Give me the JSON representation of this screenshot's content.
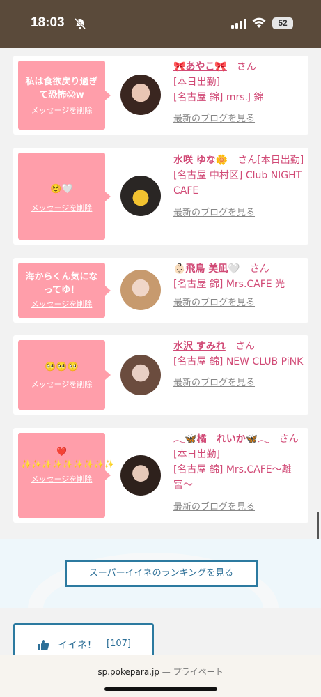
{
  "status_bar": {
    "time": "18:03",
    "battery": "52"
  },
  "cards": [
    {
      "message": "私は食欲戻り過ぎて恐怖😱w",
      "delete_label": "メッセージを削除",
      "name": "🎀あやこ🎀",
      "san": "さん",
      "lines": [
        "[本日出勤]",
        "[名古屋 錦] mrs.J 錦"
      ],
      "blog_label": "最新のブログを見る"
    },
    {
      "message": "☺️🤍",
      "delete_label": "メッセージを削除",
      "name": "水咲 ゆな🌼",
      "san": "さん[本日出勤]",
      "lines": [
        "[名古屋 中村区] Club NIGHT CAFE"
      ],
      "blog_label": "最新のブログを見る"
    },
    {
      "message": "海からくん気になってゆ！",
      "delete_label": "メッセージを削除",
      "name": "👶🏻飛鳥 美凪🤍",
      "san": "さん",
      "lines": [
        "[名古屋 錦] Mrs.CAFE 光"
      ],
      "blog_label": "最新のブログを見る"
    },
    {
      "message": "🥺🥺🥺",
      "delete_label": "メッセージを削除",
      "name": "水沢 すみれ",
      "san": "さん",
      "lines": [
        "[名古屋 錦] NEW CLUB PiNK"
      ],
      "blog_label": "最新のブログを見る"
    },
    {
      "message": "❤️ ✨✨✨✨✨✨✨✨✨",
      "delete_label": "メッセージを削除",
      "name": "𓂃🦋橘　れいか🦋𓂃",
      "san": "さん[本日出勤]",
      "lines": [
        "[名古屋 錦] Mrs.CAFE〜離宮〜"
      ],
      "blog_label": "最新のブログを見る"
    }
  ],
  "ranking_button": "スーパーイイネのランキングを見る",
  "like_button": {
    "label": "イイネ！",
    "count": "[107]"
  },
  "address_bar": {
    "url": "sp.pokepara.jp",
    "privacy": "— プライベート"
  },
  "colors": {
    "accent_pink": "#ff9eaa",
    "name_pink": "#d14a76",
    "status_brown": "#5a4a3a",
    "button_blue": "#2c7aa0"
  }
}
